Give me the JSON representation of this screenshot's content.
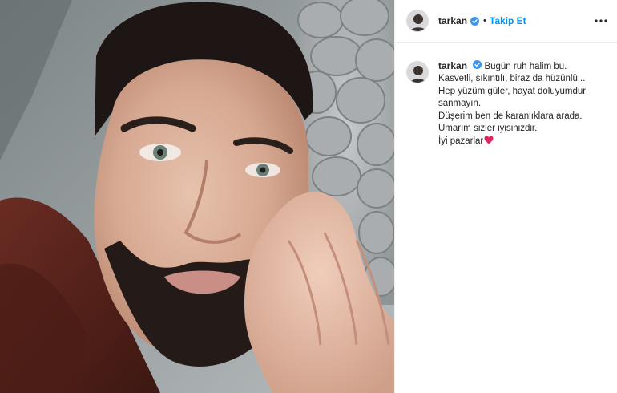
{
  "post": {
    "username": "tarkan",
    "follow_label": "Takip Et",
    "separator": "•",
    "more_icon": "more-dots-icon",
    "verified_icon": "verified-badge-icon"
  },
  "caption": {
    "username": "tarkan",
    "first_line": "Bugün ruh halim bu.",
    "lines": [
      "Kasvetli, sıkıntılı, biraz da hüzünlü...",
      "Hep yüzüm güler, hayat doluyumdur",
      "sanmayın.",
      "Düşerim ben de karanlıklara arada.",
      "Umarım sizler iyisinizdir.",
      "İyi pazarlar"
    ],
    "emoji": "red-heart-icon"
  },
  "colors": {
    "follow_blue": "#0095f6",
    "verified_blue": "#3897f0",
    "heart_red": "#e0245e"
  }
}
